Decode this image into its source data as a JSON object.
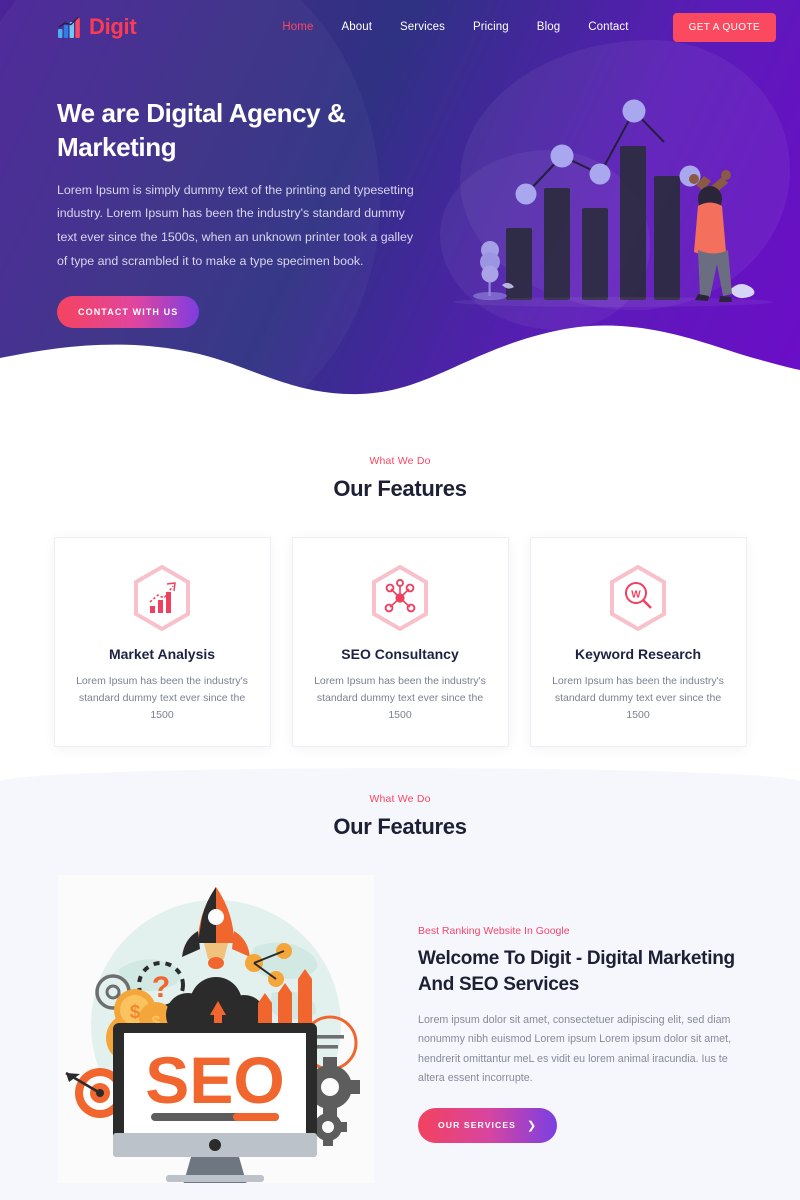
{
  "brand": {
    "name": "Digit",
    "logo_icon": "bar-chart-icon"
  },
  "nav": {
    "links": [
      {
        "label": "Home",
        "active": true
      },
      {
        "label": "About",
        "active": false
      },
      {
        "label": "Services",
        "active": false
      },
      {
        "label": "Pricing",
        "active": false
      },
      {
        "label": "Blog",
        "active": false
      },
      {
        "label": "Contact",
        "active": false
      }
    ],
    "cta_label": "GET A QUOTE"
  },
  "hero": {
    "title": "We are Digital Agency & Marketing",
    "description": "Lorem Ipsum is simply dummy text of the printing and typesetting industry. Lorem Ipsum has been the industry's standard dummy text ever since the 1500s, when an unknown printer took a galley of type and scrambled it to make a type specimen book.",
    "cta_label": "CONTACT WITH US",
    "illustration": "growth-chart-person-illustration"
  },
  "features_1": {
    "kicker": "What We Do",
    "title": "Our Features",
    "cards": [
      {
        "icon": "bar-chart-arrow-icon",
        "title": "Market Analysis",
        "desc": "Lorem Ipsum has been the industry's standard dummy text ever since the 1500"
      },
      {
        "icon": "network-nodes-icon",
        "title": "SEO Consultancy",
        "desc": "Lorem Ipsum has been the industry's standard dummy text ever since the 1500"
      },
      {
        "icon": "magnifier-w-icon",
        "title": "Keyword Research",
        "desc": "Lorem Ipsum has been the industry's standard dummy text ever since the 1500"
      }
    ]
  },
  "features_2": {
    "kicker": "What We Do",
    "title": "Our Features",
    "image": "seo-monitor-rocket-illustration",
    "image_text": "SEO",
    "sub_kicker": "Best Ranking Website In Google",
    "heading": "Welcome To Digit - Digital Marketing And SEO Services",
    "description": "Lorem ipsum dolor sit amet, consectetuer adipiscing elit, sed diam nonummy nibh euismod Lorem ipsum Lorem ipsum dolor sit amet, hendrerit omittantur meL es vidit eu lorem animal iracundia. Ius te altera essent incorrupte.",
    "cta_label": "OUR SERVICES",
    "cta_icon": "chevron-right-icon"
  },
  "colors": {
    "accent_pink": "#fb4661",
    "hero_purple_left": "#3b2f86",
    "hero_purple_right": "#6d0cc9",
    "dark_text": "#1d2035",
    "section_bg": "#f6f7fc"
  }
}
